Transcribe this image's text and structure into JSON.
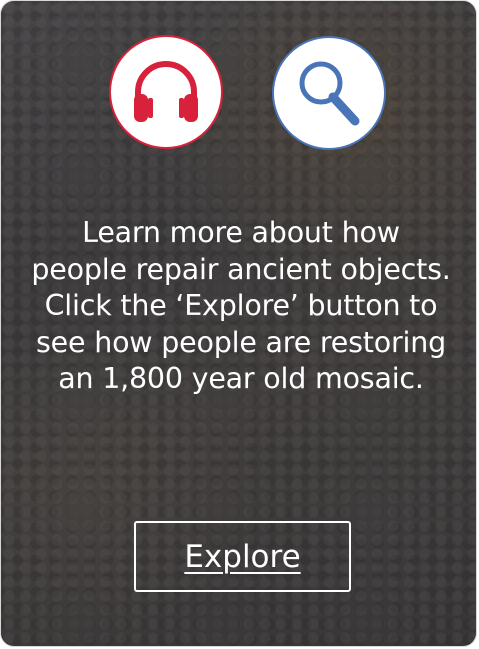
{
  "card": {
    "message": "Learn more about how people repair ancient objects. Click the ‘Explore’ button to see how people are restoring an 1,800 year old mosaic.",
    "explore_label": "Explore"
  },
  "icons": {
    "audio": "headphones-icon",
    "search": "magnifier-icon"
  },
  "colors": {
    "audio_accent": "#d8213a",
    "search_accent": "#4a74b8",
    "text": "#ffffff"
  }
}
